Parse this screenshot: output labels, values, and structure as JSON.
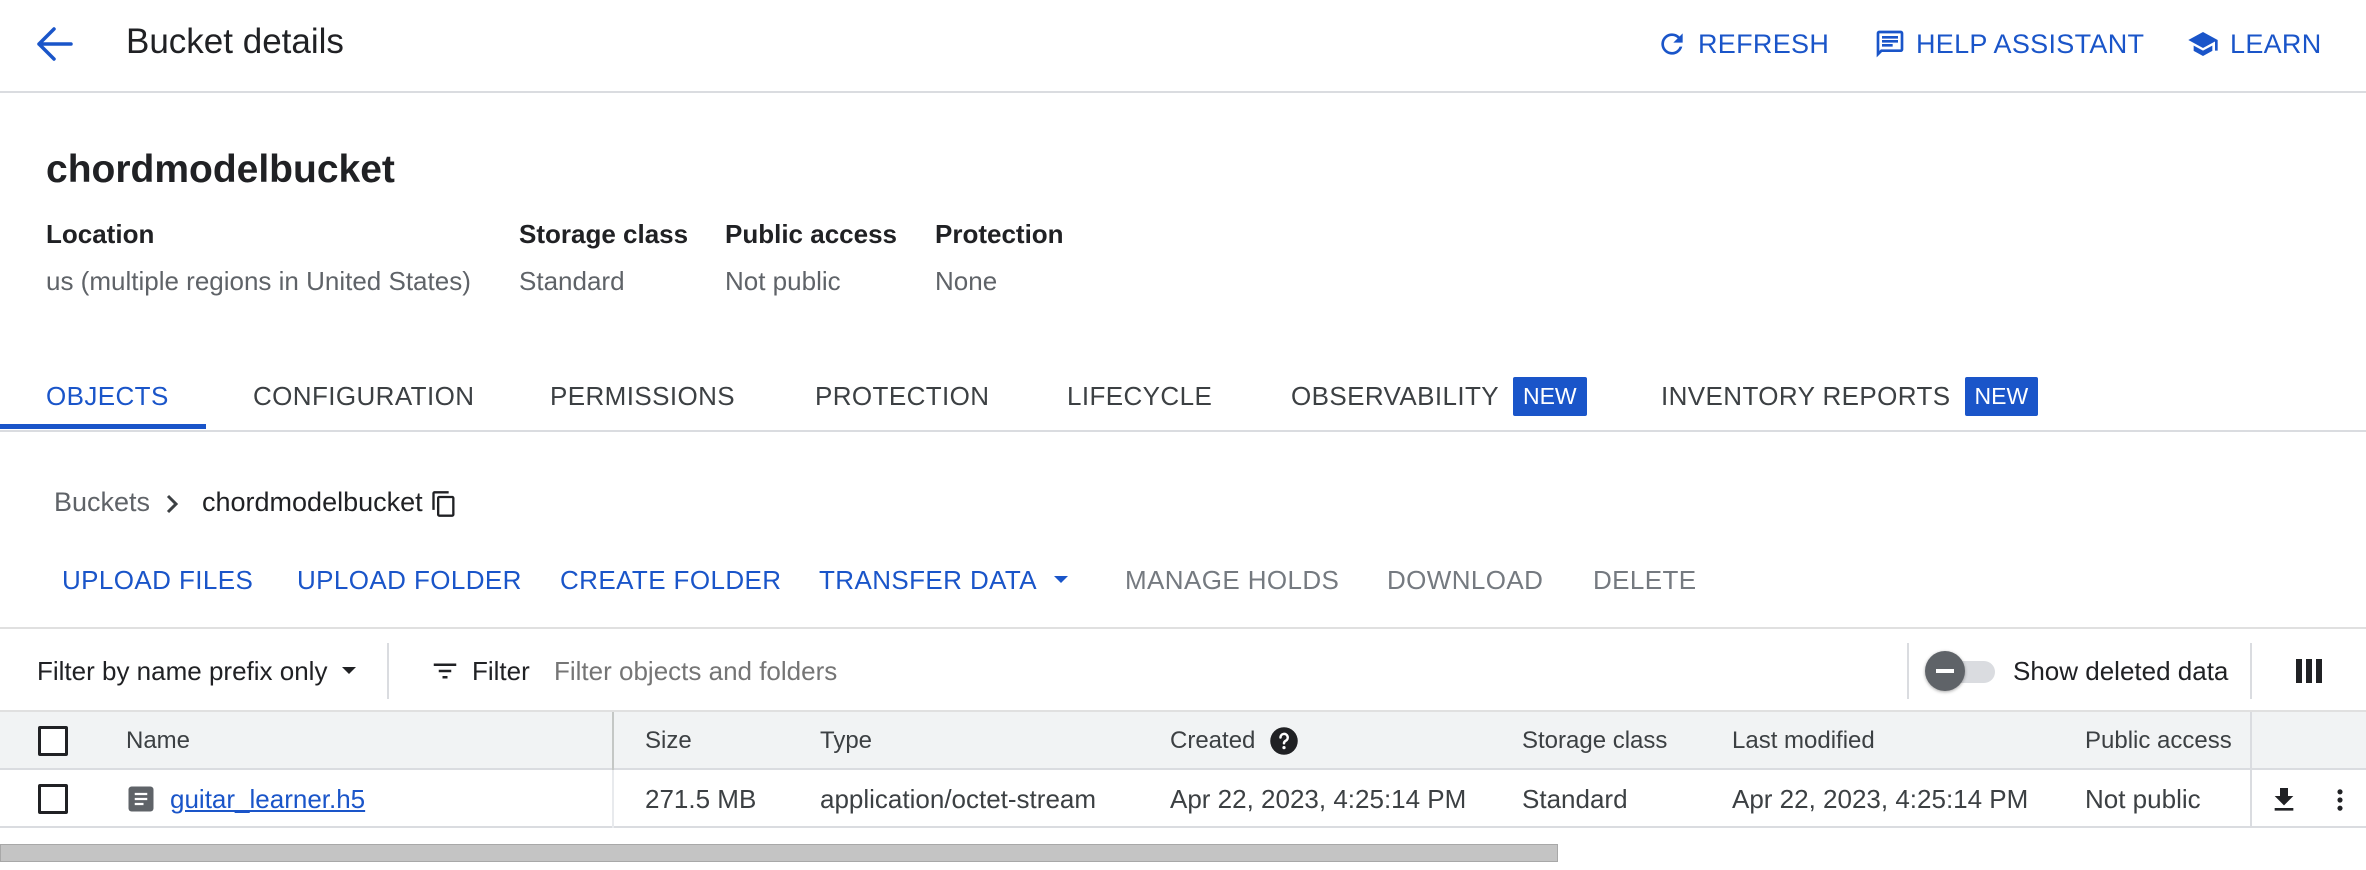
{
  "header": {
    "title": "Bucket details",
    "refresh": "REFRESH",
    "help_assistant": "HELP ASSISTANT",
    "learn": "LEARN"
  },
  "bucket": {
    "name": "chordmodelbucket",
    "meta": [
      {
        "label": "Location",
        "value": "us (multiple regions in United States)"
      },
      {
        "label": "Storage class",
        "value": "Standard"
      },
      {
        "label": "Public access",
        "value": "Not public"
      },
      {
        "label": "Protection",
        "value": "None"
      }
    ]
  },
  "tabs": [
    {
      "label": "OBJECTS",
      "active": true
    },
    {
      "label": "CONFIGURATION"
    },
    {
      "label": "PERMISSIONS"
    },
    {
      "label": "PROTECTION"
    },
    {
      "label": "LIFECYCLE"
    },
    {
      "label": "OBSERVABILITY",
      "badge": "NEW"
    },
    {
      "label": "INVENTORY REPORTS",
      "badge": "NEW"
    }
  ],
  "breadcrumb": {
    "root": "Buckets",
    "current": "chordmodelbucket"
  },
  "actions": {
    "upload_files": "UPLOAD FILES",
    "upload_folder": "UPLOAD FOLDER",
    "create_folder": "CREATE FOLDER",
    "transfer_data": "TRANSFER DATA",
    "manage_holds": "MANAGE HOLDS",
    "download": "DOWNLOAD",
    "delete": "DELETE"
  },
  "filter": {
    "prefix_select": "Filter by name prefix only",
    "filter_label": "Filter",
    "placeholder": "Filter objects and folders",
    "show_deleted": "Show deleted data"
  },
  "table": {
    "columns": [
      "Name",
      "Size",
      "Type",
      "Created",
      "Storage class",
      "Last modified",
      "Public access"
    ],
    "rows": [
      {
        "name": "guitar_learner.h5",
        "size": "271.5 MB",
        "type": "application/octet-stream",
        "created": "Apr 22, 2023, 4:25:14 PM",
        "storage_class": "Standard",
        "last_modified": "Apr 22, 2023, 4:25:14 PM",
        "public_access": "Not public"
      }
    ]
  },
  "colors": {
    "accent": "#1a55c9",
    "text": "#202124",
    "muted": "#5f6368",
    "divider": "#dadce0"
  }
}
